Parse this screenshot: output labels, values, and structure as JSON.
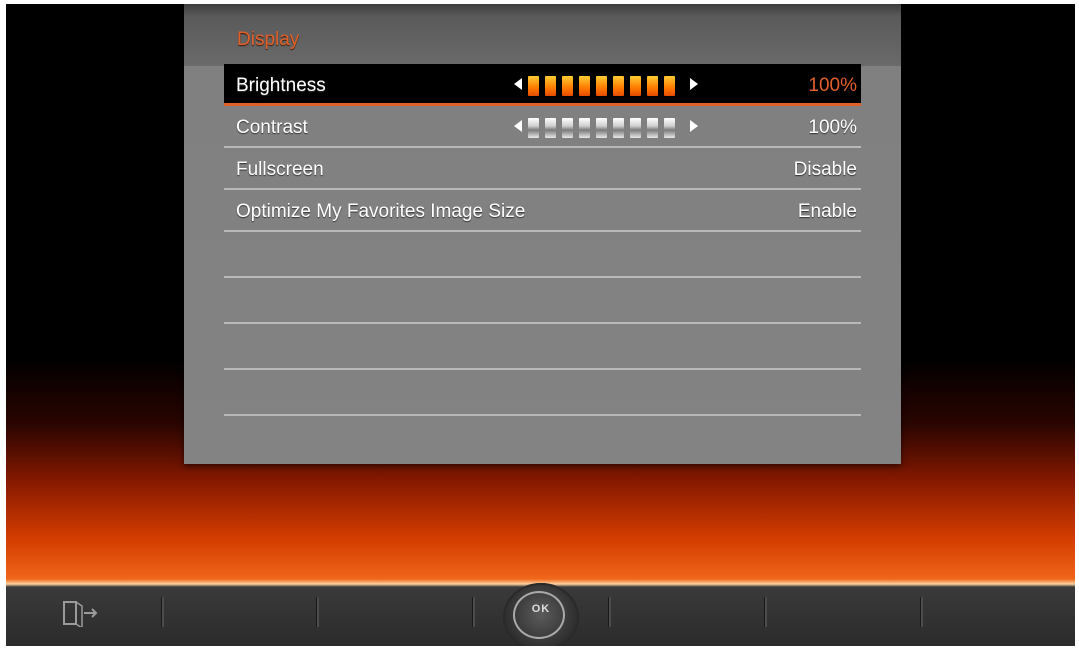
{
  "menu": {
    "title": "Display",
    "items": [
      {
        "label": "Brightness",
        "value": "100%",
        "level": 1.0,
        "segments": 9,
        "selected": true
      },
      {
        "label": "Contrast",
        "value": "100%",
        "level": 1.0,
        "segments": 9,
        "selected": false
      },
      {
        "label": "Fullscreen",
        "value": "Disable"
      },
      {
        "label": "Optimize My Favorites Image Size",
        "value": "Enable"
      }
    ]
  },
  "bottom_bar": {
    "exit_icon": "exit-icon",
    "ok_label": "OK"
  },
  "colors": {
    "accent": "#e0602a",
    "panel": "#838383",
    "selected_row": "#000000"
  }
}
